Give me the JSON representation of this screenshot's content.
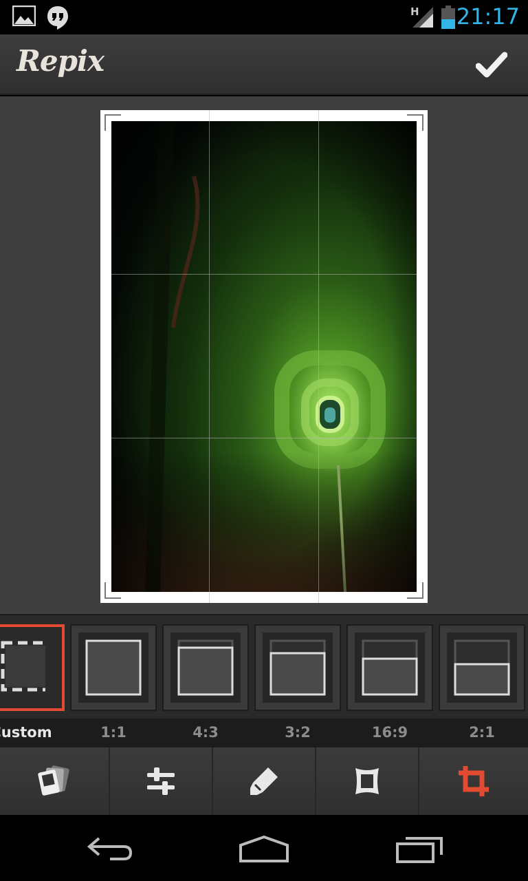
{
  "status_bar": {
    "time": "21:17",
    "network_label": "H",
    "icons": [
      "gallery-icon",
      "hangouts-icon",
      "signal-icon",
      "battery-icon"
    ]
  },
  "app": {
    "name": "Repix",
    "confirm_icon": "checkmark-icon"
  },
  "crop": {
    "aspect_options": [
      {
        "label": "Custom",
        "selected": true
      },
      {
        "label": "1:1",
        "selected": false
      },
      {
        "label": "4:3",
        "selected": false
      },
      {
        "label": "3:2",
        "selected": false
      },
      {
        "label": "16:9",
        "selected": false
      },
      {
        "label": "2:1",
        "selected": false
      }
    ],
    "accent_color": "#e24b31"
  },
  "toolbar": {
    "tools": [
      {
        "icon": "photos-icon",
        "active": false
      },
      {
        "icon": "adjust-sliders-icon",
        "active": false
      },
      {
        "icon": "brush-icon",
        "active": false
      },
      {
        "icon": "frame-icon",
        "active": false
      },
      {
        "icon": "crop-icon",
        "active": true
      }
    ]
  },
  "nav_bar": {
    "icons": [
      "back-icon",
      "home-icon",
      "recents-icon"
    ]
  }
}
